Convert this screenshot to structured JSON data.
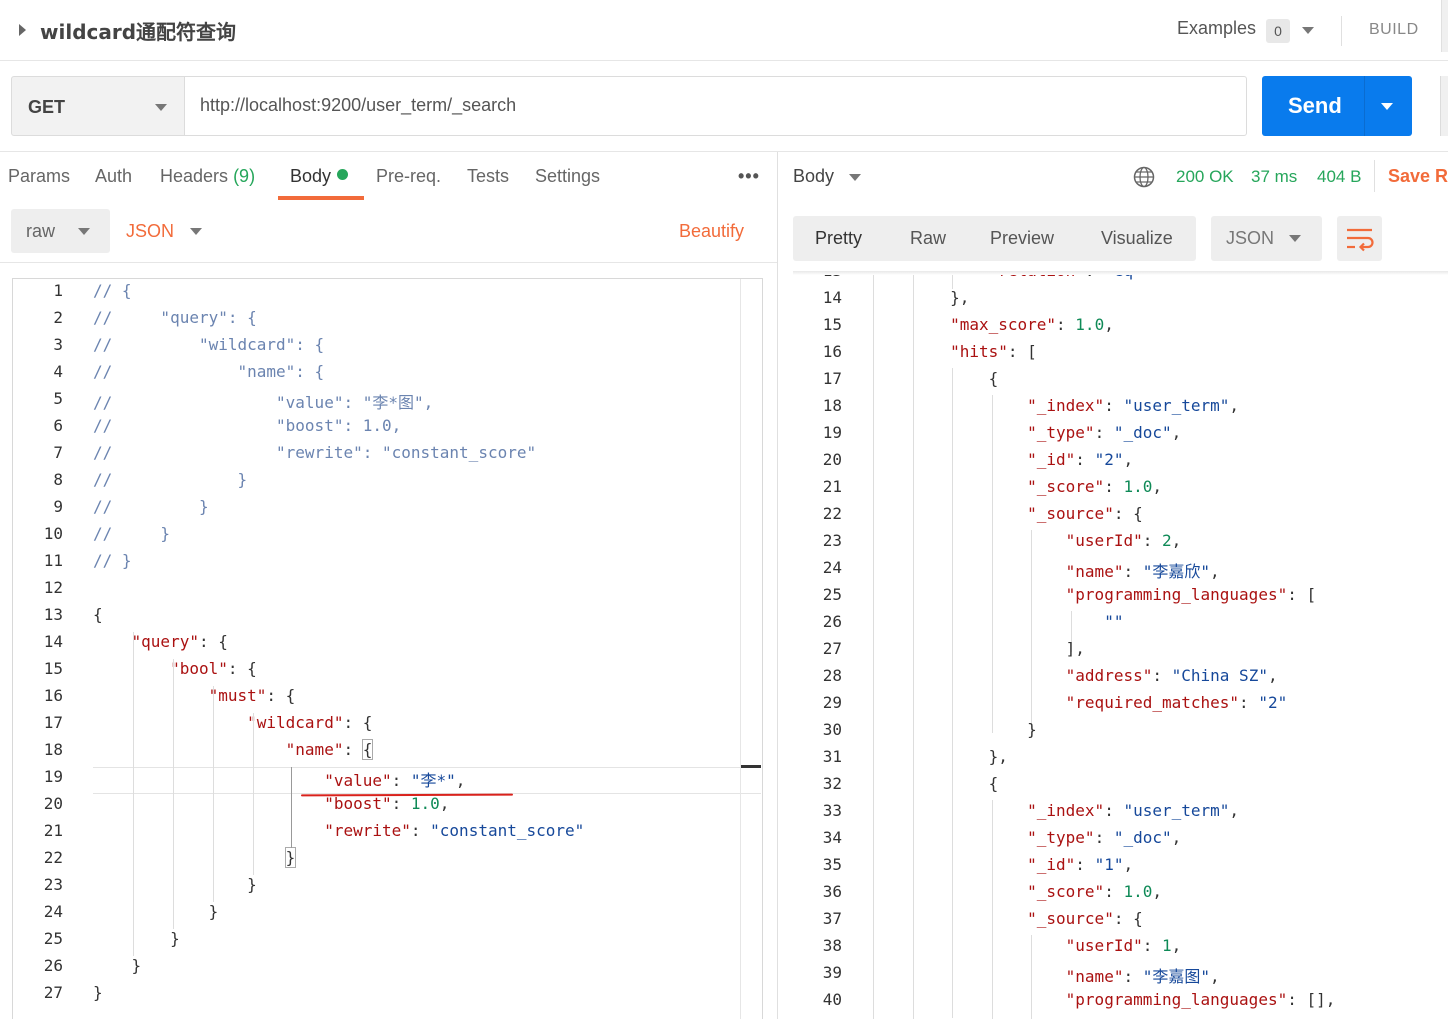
{
  "header": {
    "request_title": "wildcard通配符查询",
    "examples_label": "Examples",
    "examples_count": "0",
    "build_label": "BUILD"
  },
  "request": {
    "method": "GET",
    "url": "http://localhost:9200/user_term/_search",
    "send_label": "Send"
  },
  "request_tabs": {
    "params": "Params",
    "auth": "Auth",
    "headers": "Headers",
    "headers_count": "(9)",
    "body": "Body",
    "prereq": "Pre-req.",
    "tests": "Tests",
    "settings": "Settings",
    "more": "•••"
  },
  "body_options": {
    "mode": "raw",
    "format": "JSON",
    "beautify": "Beautify"
  },
  "editor_lines": [
    [
      [
        "cmt",
        "// {"
      ]
    ],
    [
      [
        "cmt",
        "//     \"query\": {"
      ]
    ],
    [
      [
        "cmt",
        "//         \"wildcard\": {"
      ]
    ],
    [
      [
        "cmt",
        "//             \"name\": {"
      ]
    ],
    [
      [
        "cmt",
        "//                 \"value\": \"李*图\","
      ]
    ],
    [
      [
        "cmt",
        "//                 \"boost\": 1.0,"
      ]
    ],
    [
      [
        "cmt",
        "//                 \"rewrite\": \"constant_score\""
      ]
    ],
    [
      [
        "cmt",
        "//             }"
      ]
    ],
    [
      [
        "cmt",
        "//         }"
      ]
    ],
    [
      [
        "cmt",
        "//     }"
      ]
    ],
    [
      [
        "cmt",
        "// }"
      ]
    ],
    [],
    [
      [
        "p",
        "{"
      ]
    ],
    [
      [
        "p",
        "    "
      ],
      [
        "k",
        "\"query\""
      ],
      [
        "p",
        ": {"
      ]
    ],
    [
      [
        "p",
        "        "
      ],
      [
        "k",
        "\"bool\""
      ],
      [
        "p",
        ": {"
      ]
    ],
    [
      [
        "p",
        "            "
      ],
      [
        "k",
        "\"must\""
      ],
      [
        "p",
        ": {"
      ]
    ],
    [
      [
        "p",
        "                "
      ],
      [
        "k",
        "\"wildcard\""
      ],
      [
        "p",
        ": {"
      ]
    ],
    [
      [
        "p",
        "                    "
      ],
      [
        "k",
        "\"name\""
      ],
      [
        "p",
        ": "
      ],
      [
        "box",
        "{"
      ]
    ],
    [
      [
        "p",
        "                        "
      ],
      [
        "k",
        "\"value\""
      ],
      [
        "p",
        ": "
      ],
      [
        "s",
        "\"李*\""
      ],
      [
        "p",
        ","
      ]
    ],
    [
      [
        "p",
        "                        "
      ],
      [
        "k",
        "\"boost\""
      ],
      [
        "p",
        ": "
      ],
      [
        "n",
        "1.0"
      ],
      [
        "p",
        ","
      ]
    ],
    [
      [
        "p",
        "                        "
      ],
      [
        "k",
        "\"rewrite\""
      ],
      [
        "p",
        ": "
      ],
      [
        "s",
        "\"constant_score\""
      ]
    ],
    [
      [
        "p",
        "                    "
      ],
      [
        "box",
        "}"
      ]
    ],
    [
      [
        "p",
        "                }"
      ]
    ],
    [
      [
        "p",
        "            }"
      ]
    ],
    [
      [
        "p",
        "        }"
      ]
    ],
    [
      [
        "p",
        "    }"
      ]
    ],
    [
      [
        "p",
        "}"
      ]
    ]
  ],
  "response_header": {
    "body_label": "Body",
    "status": "200 OK",
    "time": "37 ms",
    "size": "404 B",
    "save_label": "Save Re"
  },
  "response_view": {
    "pretty": "Pretty",
    "raw": "Raw",
    "preview": "Preview",
    "visualize": "Visualize",
    "format": "JSON"
  },
  "response_first_line": 13,
  "response_lines": [
    [
      [
        "p",
        "            "
      ],
      [
        "k",
        "\"relation\""
      ],
      [
        "p",
        ": "
      ],
      [
        "s",
        "\"eq\""
      ]
    ],
    [
      [
        "p",
        "        },"
      ]
    ],
    [
      [
        "p",
        "        "
      ],
      [
        "k",
        "\"max_score\""
      ],
      [
        "p",
        ": "
      ],
      [
        "n",
        "1.0"
      ],
      [
        "p",
        ","
      ]
    ],
    [
      [
        "p",
        "        "
      ],
      [
        "k",
        "\"hits\""
      ],
      [
        "p",
        ": ["
      ]
    ],
    [
      [
        "p",
        "            {"
      ]
    ],
    [
      [
        "p",
        "                "
      ],
      [
        "k",
        "\"_index\""
      ],
      [
        "p",
        ": "
      ],
      [
        "s",
        "\"user_term\""
      ],
      [
        "p",
        ","
      ]
    ],
    [
      [
        "p",
        "                "
      ],
      [
        "k",
        "\"_type\""
      ],
      [
        "p",
        ": "
      ],
      [
        "s",
        "\"_doc\""
      ],
      [
        "p",
        ","
      ]
    ],
    [
      [
        "p",
        "                "
      ],
      [
        "k",
        "\"_id\""
      ],
      [
        "p",
        ": "
      ],
      [
        "s",
        "\"2\""
      ],
      [
        "p",
        ","
      ]
    ],
    [
      [
        "p",
        "                "
      ],
      [
        "k",
        "\"_score\""
      ],
      [
        "p",
        ": "
      ],
      [
        "n",
        "1.0"
      ],
      [
        "p",
        ","
      ]
    ],
    [
      [
        "p",
        "                "
      ],
      [
        "k",
        "\"_source\""
      ],
      [
        "p",
        ": {"
      ]
    ],
    [
      [
        "p",
        "                    "
      ],
      [
        "k",
        "\"userId\""
      ],
      [
        "p",
        ": "
      ],
      [
        "n",
        "2"
      ],
      [
        "p",
        ","
      ]
    ],
    [
      [
        "p",
        "                    "
      ],
      [
        "k",
        "\"name\""
      ],
      [
        "p",
        ": "
      ],
      [
        "s",
        "\"李嘉欣\""
      ],
      [
        "p",
        ","
      ]
    ],
    [
      [
        "p",
        "                    "
      ],
      [
        "k",
        "\"programming_languages\""
      ],
      [
        "p",
        ": ["
      ]
    ],
    [
      [
        "p",
        "                        "
      ],
      [
        "s",
        "\"\""
      ]
    ],
    [
      [
        "p",
        "                    ],"
      ]
    ],
    [
      [
        "p",
        "                    "
      ],
      [
        "k",
        "\"address\""
      ],
      [
        "p",
        ": "
      ],
      [
        "s",
        "\"China SZ\""
      ],
      [
        "p",
        ","
      ]
    ],
    [
      [
        "p",
        "                    "
      ],
      [
        "k",
        "\"required_matches\""
      ],
      [
        "p",
        ": "
      ],
      [
        "s",
        "\"2\""
      ]
    ],
    [
      [
        "p",
        "                }"
      ]
    ],
    [
      [
        "p",
        "            },"
      ]
    ],
    [
      [
        "p",
        "            {"
      ]
    ],
    [
      [
        "p",
        "                "
      ],
      [
        "k",
        "\"_index\""
      ],
      [
        "p",
        ": "
      ],
      [
        "s",
        "\"user_term\""
      ],
      [
        "p",
        ","
      ]
    ],
    [
      [
        "p",
        "                "
      ],
      [
        "k",
        "\"_type\""
      ],
      [
        "p",
        ": "
      ],
      [
        "s",
        "\"_doc\""
      ],
      [
        "p",
        ","
      ]
    ],
    [
      [
        "p",
        "                "
      ],
      [
        "k",
        "\"_id\""
      ],
      [
        "p",
        ": "
      ],
      [
        "s",
        "\"1\""
      ],
      [
        "p",
        ","
      ]
    ],
    [
      [
        "p",
        "                "
      ],
      [
        "k",
        "\"_score\""
      ],
      [
        "p",
        ": "
      ],
      [
        "n",
        "1.0"
      ],
      [
        "p",
        ","
      ]
    ],
    [
      [
        "p",
        "                "
      ],
      [
        "k",
        "\"_source\""
      ],
      [
        "p",
        ": {"
      ]
    ],
    [
      [
        "p",
        "                    "
      ],
      [
        "k",
        "\"userId\""
      ],
      [
        "p",
        ": "
      ],
      [
        "n",
        "1"
      ],
      [
        "p",
        ","
      ]
    ],
    [
      [
        "p",
        "                    "
      ],
      [
        "k",
        "\"name\""
      ],
      [
        "p",
        ": "
      ],
      [
        "s",
        "\"李嘉图\""
      ],
      [
        "p",
        ","
      ]
    ],
    [
      [
        "p",
        "                    "
      ],
      [
        "k",
        "\"programming_languages\""
      ],
      [
        "p",
        ": [],"
      ]
    ]
  ],
  "colors": {
    "accent_orange": "#f26b3a",
    "send_blue": "#097bed",
    "status_green": "#26a65b",
    "annotation_red": "#d9221c"
  }
}
